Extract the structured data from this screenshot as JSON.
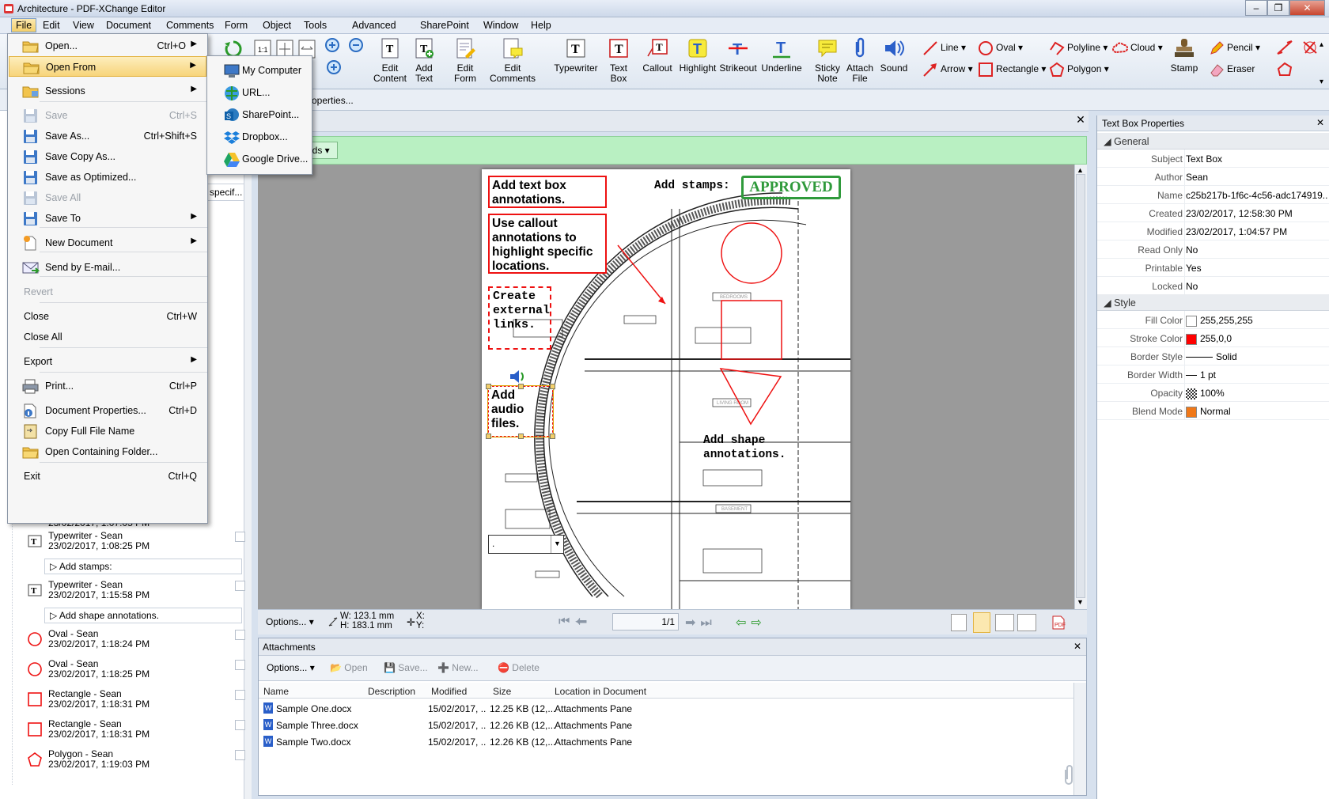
{
  "window": {
    "title": "Architecture - PDF-XChange Editor"
  },
  "menubar": [
    "File",
    "Edit",
    "View",
    "Document",
    "Comments",
    "Form",
    "Object",
    "Tools",
    "Advanced",
    "SharePoint",
    "Window",
    "Help"
  ],
  "ribbon": {
    "large": [
      {
        "label": "Edit\nContent",
        "icon": "edit-content-icon"
      },
      {
        "label": "Add\nText",
        "icon": "add-text-icon"
      },
      {
        "label": "Edit\nForm",
        "icon": "edit-form-icon"
      },
      {
        "label": "Edit\nComments",
        "icon": "edit-comments-icon"
      },
      {
        "label": "Typewriter",
        "icon": "typewriter-icon"
      },
      {
        "label": "Text\nBox",
        "icon": "text-box-icon"
      },
      {
        "label": "Callout",
        "icon": "callout-icon"
      },
      {
        "label": "Highlight",
        "icon": "highlight-icon"
      },
      {
        "label": "Strikeout",
        "icon": "strikeout-icon"
      },
      {
        "label": "Underline",
        "icon": "underline-icon"
      },
      {
        "label": "Sticky\nNote",
        "icon": "sticky-note-icon"
      },
      {
        "label": "Attach\nFile",
        "icon": "attach-file-icon"
      },
      {
        "label": "Sound",
        "icon": "sound-icon"
      },
      {
        "label": "Stamp",
        "icon": "stamp-icon"
      }
    ],
    "small": {
      "line": "Line",
      "arrow": "Arrow",
      "oval": "Oval",
      "rectangle": "Rectangle",
      "polyline": "Polyline",
      "polygon": "Polygon",
      "cloud": "Cloud",
      "pencil": "Pencil",
      "eraser": "Eraser"
    },
    "row2_text": "operties..."
  },
  "file_menu": {
    "items": [
      {
        "label": "Open...",
        "shortcut": "Ctrl+O",
        "icon": "folder-open-icon",
        "arrow": true
      },
      {
        "label": "Open From",
        "shortcut": "",
        "icon": "folder-open-from-icon",
        "arrow": true,
        "highlight": true
      },
      {
        "label": "Sessions",
        "shortcut": "",
        "icon": "sessions-icon",
        "arrow": true
      },
      {
        "label": "Save",
        "shortcut": "Ctrl+S",
        "icon": "save-icon",
        "disabled": true
      },
      {
        "label": "Save As...",
        "shortcut": "Ctrl+Shift+S",
        "icon": "save-as-icon"
      },
      {
        "label": "Save Copy As...",
        "shortcut": "",
        "icon": "save-copy-icon"
      },
      {
        "label": "Save as Optimized...",
        "shortcut": "",
        "icon": "save-optimized-icon"
      },
      {
        "label": "Save All",
        "shortcut": "",
        "icon": "save-all-icon",
        "disabled": true
      },
      {
        "label": "Save To",
        "shortcut": "",
        "icon": "save-to-icon",
        "arrow": true
      },
      {
        "label": "New Document",
        "shortcut": "",
        "icon": "new-document-icon",
        "arrow": true
      },
      {
        "label": "Send by E-mail...",
        "shortcut": "",
        "icon": "email-icon"
      },
      {
        "label": "Revert",
        "shortcut": "",
        "disabled": true
      },
      {
        "label": "Close",
        "shortcut": "Ctrl+W"
      },
      {
        "label": "Close All",
        "shortcut": ""
      },
      {
        "label": "Export",
        "shortcut": "",
        "arrow": true
      },
      {
        "label": "Print...",
        "shortcut": "Ctrl+P",
        "icon": "print-icon"
      },
      {
        "label": "Document Properties...",
        "shortcut": "Ctrl+D",
        "icon": "document-properties-icon"
      },
      {
        "label": "Copy Full File Name",
        "shortcut": "",
        "icon": "copy-file-name-icon"
      },
      {
        "label": "Open Containing Folder...",
        "shortcut": "",
        "icon": "open-folder-icon"
      },
      {
        "label": "Exit",
        "shortcut": "Ctrl+Q"
      }
    ],
    "submenu": [
      {
        "label": "My Computer",
        "icon": "computer-icon"
      },
      {
        "label": "URL...",
        "icon": "globe-icon"
      },
      {
        "label": "SharePoint...",
        "icon": "sharepoint-icon"
      },
      {
        "label": "Dropbox...",
        "icon": "dropbox-icon"
      },
      {
        "label": "Google Drive...",
        "icon": "google-drive-icon"
      }
    ]
  },
  "left_pane": {
    "partial_specif": "specif...",
    "partial_time": "23/02/2017, 1:07:05 PM",
    "annotations": [
      {
        "type": "Typewriter - Sean",
        "time": "23/02/2017, 1:08:25 PM",
        "content": "Add stamps:",
        "icon": "typewriter-icon"
      },
      {
        "type": "Typewriter - Sean",
        "time": "23/02/2017, 1:15:58 PM",
        "content": "Add shape annotations.",
        "icon": "typewriter-icon"
      },
      {
        "type": "Oval - Sean",
        "time": "23/02/2017, 1:18:24 PM",
        "icon": "oval-icon"
      },
      {
        "type": "Oval - Sean",
        "time": "23/02/2017, 1:18:25 PM",
        "icon": "oval-icon"
      },
      {
        "type": "Rectangle - Sean",
        "time": "23/02/2017, 1:18:31 PM",
        "icon": "rectangle-icon"
      },
      {
        "type": "Rectangle - Sean",
        "time": "23/02/2017, 1:18:31 PM",
        "icon": "rectangle-icon"
      },
      {
        "type": "Polygon - Sean",
        "time": "23/02/2017, 1:19:03 PM",
        "icon": "polygon-icon"
      }
    ]
  },
  "document": {
    "green_bar_text": "lds",
    "page_text": {
      "add_text_box": "Add text box annotations.",
      "callout": "Use callout annotations to highlight specific locations.",
      "external_links": "Create external links.",
      "audio": "Add audio files.",
      "stamps": "Add stamps:",
      "shape": "Add shape annotations.",
      "approved": "APPROVED",
      "bedrooms": "BEDROOMS",
      "living_room": "LIVING ROOM",
      "basement": "BASEMENT",
      "dropdown_value": "."
    },
    "status": {
      "options": "Options...",
      "width": "W: 123.1 mm",
      "height": "H: 183.1 mm",
      "x": "X:",
      "y": "Y:",
      "page": "1/1"
    }
  },
  "attachments": {
    "title": "Attachments",
    "toolbar": {
      "options": "Options...",
      "open": "Open",
      "save": "Save...",
      "new": "New...",
      "delete": "Delete"
    },
    "columns": [
      "Name",
      "Description",
      "Modified",
      "Size",
      "Location in Document"
    ],
    "rows": [
      {
        "name": "Sample One.docx",
        "description": "",
        "modified": "15/02/2017, ..",
        "size": "12.25 KB (12,...",
        "location": "Attachments Pane"
      },
      {
        "name": "Sample Three.docx",
        "description": "",
        "modified": "15/02/2017, ..",
        "size": "12.26 KB (12,...",
        "location": "Attachments Pane"
      },
      {
        "name": "Sample Two.docx",
        "description": "",
        "modified": "15/02/2017, ..",
        "size": "12.26 KB (12,...",
        "location": "Attachments Pane"
      }
    ]
  },
  "properties": {
    "title": "Text Box Properties",
    "general_label": "General",
    "style_label": "Style",
    "general": [
      {
        "key": "Subject",
        "value": "Text Box"
      },
      {
        "key": "Author",
        "value": "Sean"
      },
      {
        "key": "Name",
        "value": "c25b217b-1f6c-4c56-adc174919..."
      },
      {
        "key": "Created",
        "value": "23/02/2017, 12:58:30 PM"
      },
      {
        "key": "Modified",
        "value": "23/02/2017, 1:04:57 PM"
      },
      {
        "key": "Read Only",
        "value": "No"
      },
      {
        "key": "Printable",
        "value": "Yes"
      },
      {
        "key": "Locked",
        "value": "No"
      }
    ],
    "style": [
      {
        "key": "Fill Color",
        "value": "255,255,255",
        "swatch": "#ffffff"
      },
      {
        "key": "Stroke Color",
        "value": "255,0,0",
        "swatch": "#ff0000"
      },
      {
        "key": "Border Style",
        "value": "Solid"
      },
      {
        "key": "Border Width",
        "value": "1 pt"
      },
      {
        "key": "Opacity",
        "value": "100%"
      },
      {
        "key": "Blend Mode",
        "value": "Normal",
        "swatch": "#f07818"
      }
    ]
  },
  "colors": {
    "accent": "#f3cf6a",
    "annotation_red": "#ee1111",
    "approved_green": "#2f9a3b"
  }
}
